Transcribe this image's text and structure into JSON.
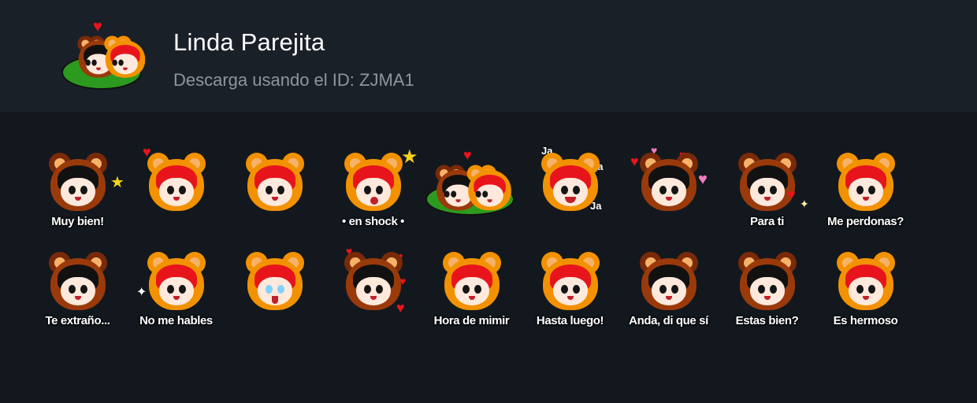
{
  "header": {
    "title": "Linda Parejita",
    "subtitle": "Descarga usando el ID: ZJMA1"
  },
  "stickers": [
    {
      "caption": "Muy bien!"
    },
    {
      "caption": ""
    },
    {
      "caption": ""
    },
    {
      "caption": "• en shock •"
    },
    {
      "caption": ""
    },
    {
      "caption": "",
      "ja": [
        "Ja",
        "Ja",
        "Ja"
      ]
    },
    {
      "caption": ""
    },
    {
      "caption": "Para ti"
    },
    {
      "caption": "Me perdonas?"
    },
    {
      "caption": "Te extraño..."
    },
    {
      "caption": "No me hables"
    },
    {
      "caption": ""
    },
    {
      "caption": ""
    },
    {
      "caption": "Hora de mimir"
    },
    {
      "caption": "Hasta luego!"
    },
    {
      "caption": "Anda, di que sí"
    },
    {
      "caption": "Estas bien?"
    },
    {
      "caption": "Es hermoso"
    }
  ],
  "icons": {
    "heart": "♥",
    "star": "★",
    "sparkle": "✦"
  },
  "colors": {
    "background": "#13181f",
    "header_background": "#1a2028",
    "title": "#ffffff",
    "subtitle": "#8f959c",
    "hood_orange": "#f29200",
    "hair_red": "#e8141c",
    "hood_brown": "#9a3a0a"
  }
}
